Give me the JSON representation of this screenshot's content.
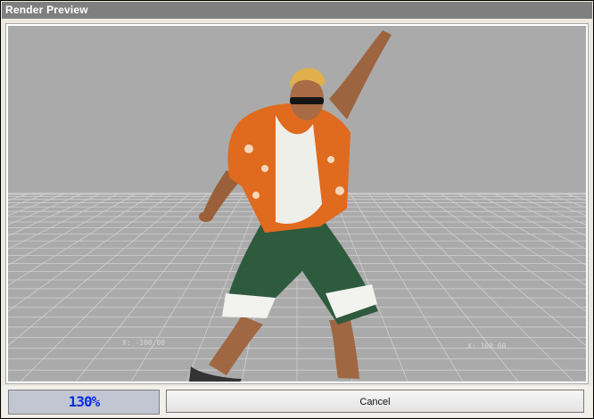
{
  "window": {
    "title": "Render Preview"
  },
  "viewport": {
    "grid_label_left": "X: -100.00",
    "grid_label_right": "X: 100.00",
    "background_color": "#a9a9a9",
    "grid_color": "#cfcfcf"
  },
  "footer": {
    "progress_label": "130%",
    "progress_fraction": 1.0,
    "cancel_label": "Cancel"
  },
  "character": {
    "shirt_color": "#e06a1e",
    "tank_color": "#efefea",
    "shorts_color": "#2f5b3e",
    "skin_color": "#a86b43",
    "hair_color": "#e0b04c"
  }
}
